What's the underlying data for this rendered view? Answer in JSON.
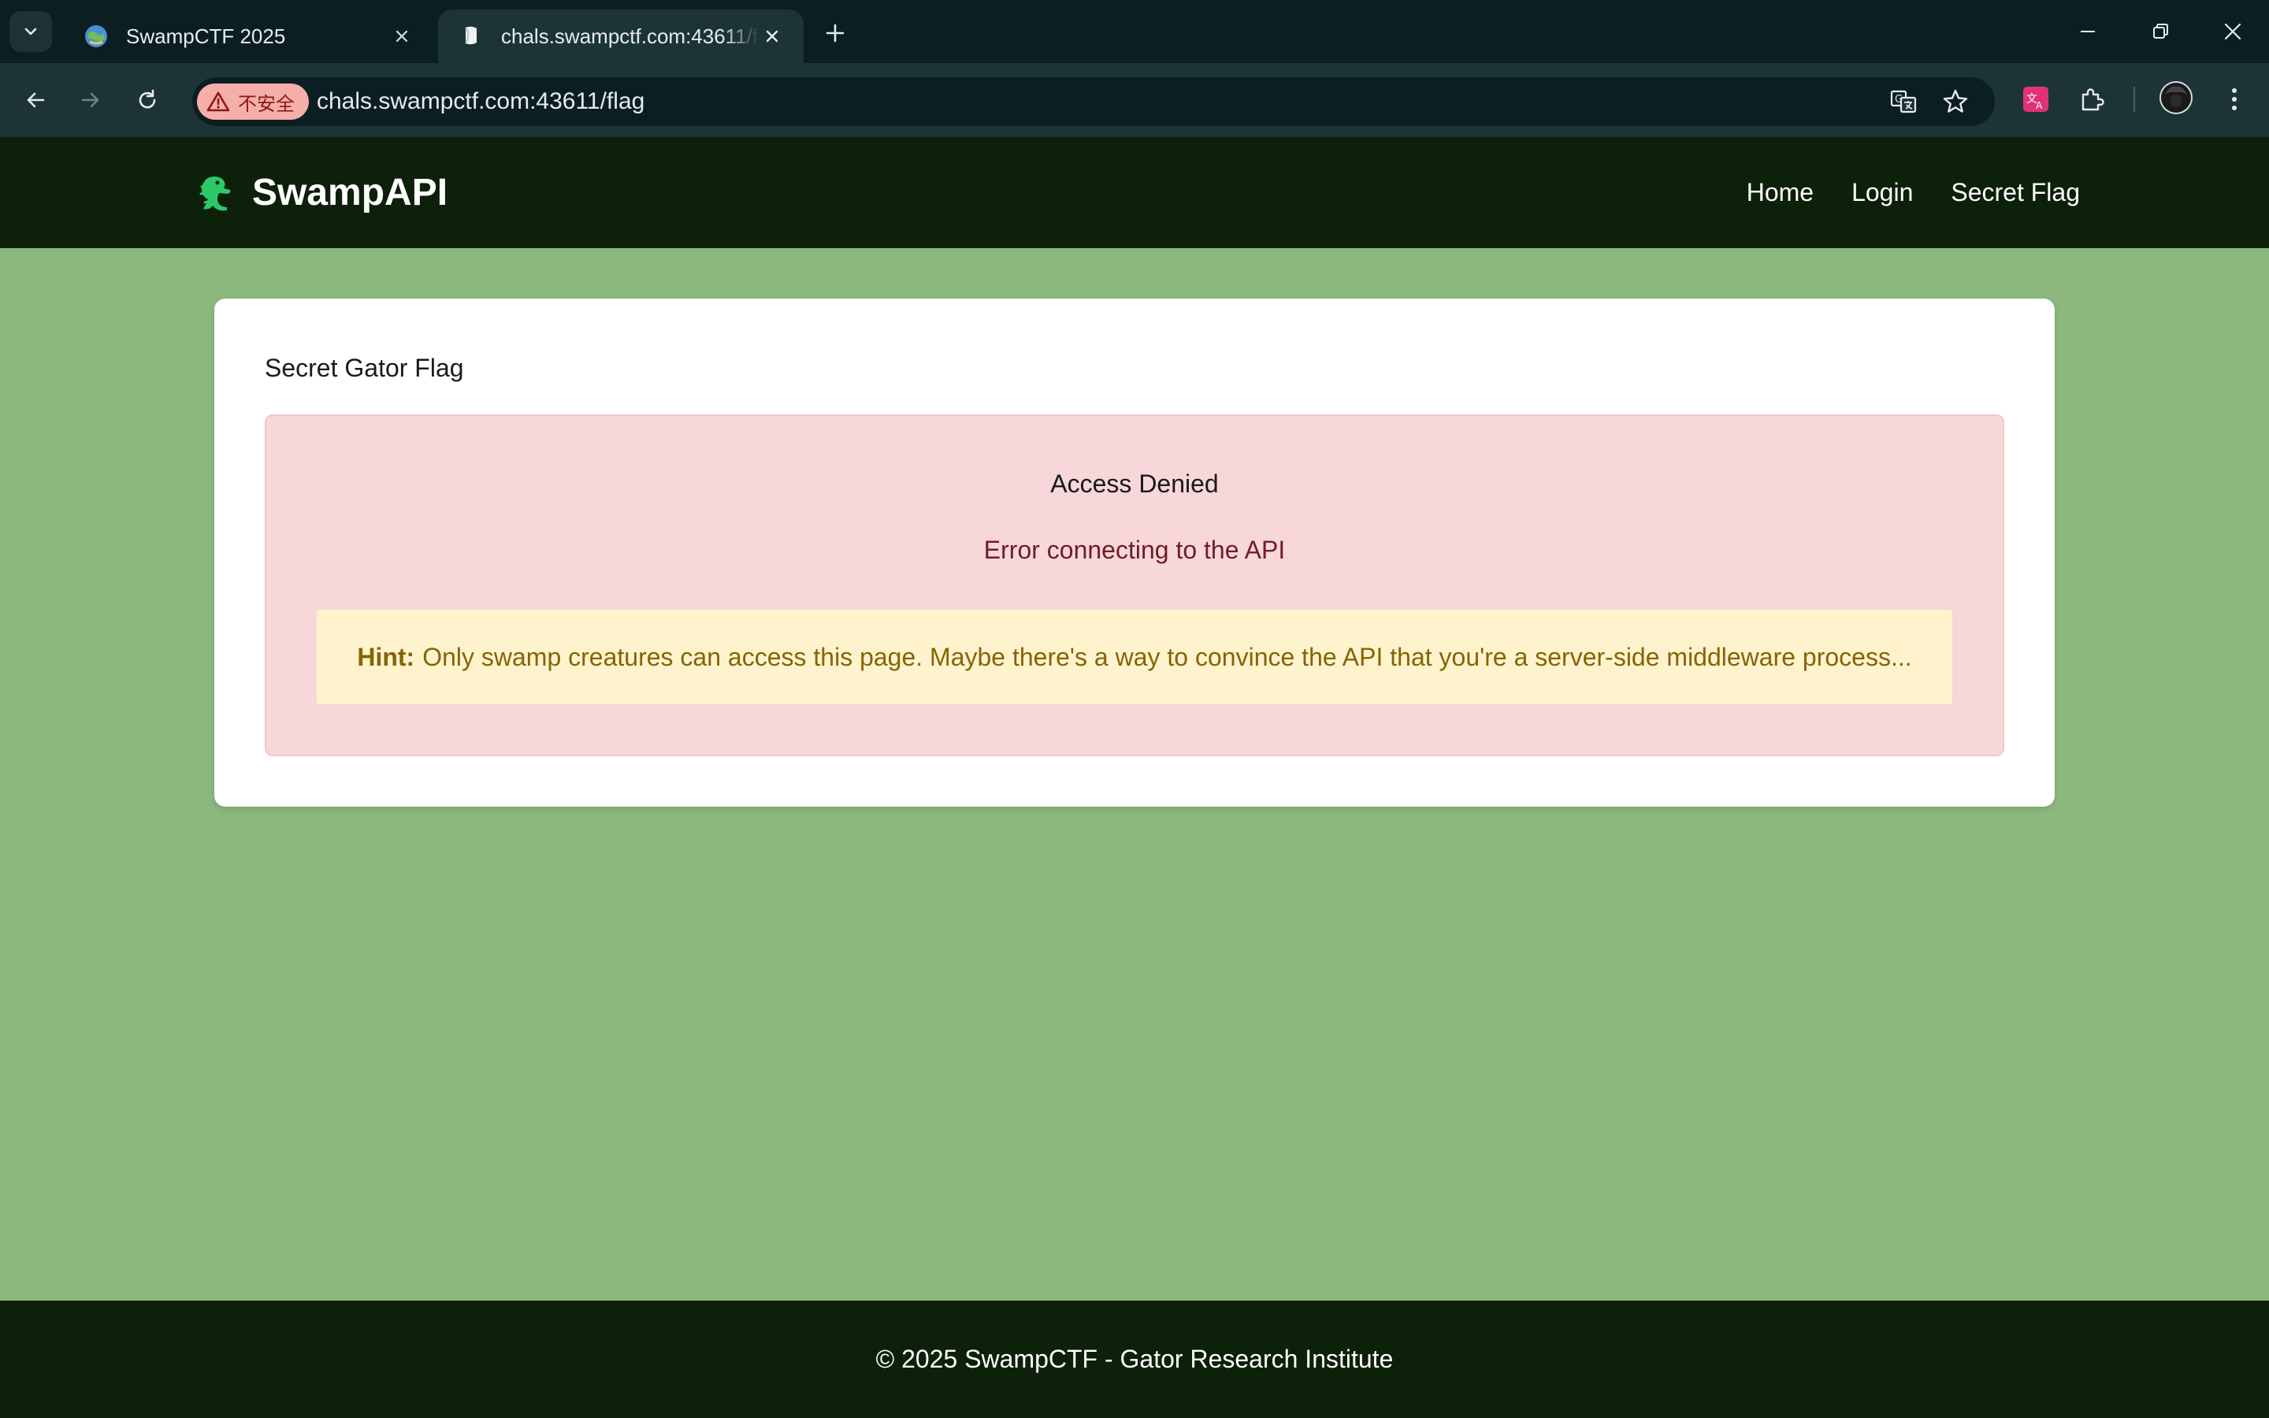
{
  "browser": {
    "tabs": [
      {
        "title": "SwampCTF 2025",
        "active": false
      },
      {
        "title": "chals.swampctf.com:43611/flag",
        "active": true
      }
    ],
    "security_label": "不安全",
    "url": "chals.swampctf.com:43611/flag",
    "colors": {
      "tabbar": "#0b1f23",
      "toolbar": "#1d3437",
      "security_chip": "#f6aea8"
    }
  },
  "site": {
    "brand": "SwampAPI",
    "nav": {
      "home": "Home",
      "login": "Login",
      "secret_flag": "Secret Flag"
    }
  },
  "main": {
    "card_title": "Secret Gator Flag",
    "alert": {
      "heading": "Access Denied",
      "message": "Error connecting to the API",
      "hint_label": "Hint:",
      "hint_text": "Only swamp creatures can access this page. Maybe there's a way to convince the API that you're a server-side middleware process..."
    }
  },
  "footer": {
    "text": "© 2025 SwampCTF - Gator Research Institute"
  },
  "icons": [
    "tab-search-icon",
    "globe-favicon-icon",
    "page-favicon-icon",
    "close-icon",
    "plus-icon",
    "minimize-icon",
    "restore-icon",
    "back-arrow-icon",
    "forward-arrow-icon",
    "reload-icon",
    "warning-icon",
    "translate-icon",
    "star-icon",
    "extension-icon",
    "puzzle-icon",
    "avatar",
    "kebab-menu-icon",
    "gator-logo-icon"
  ],
  "colors": {
    "page_bg": "#8cb87e",
    "header_bg": "#0d2009",
    "alert_bg": "#f7d7da",
    "alert_text": "#721c24",
    "hint_bg": "#fff3cd",
    "hint_text": "#856404"
  }
}
